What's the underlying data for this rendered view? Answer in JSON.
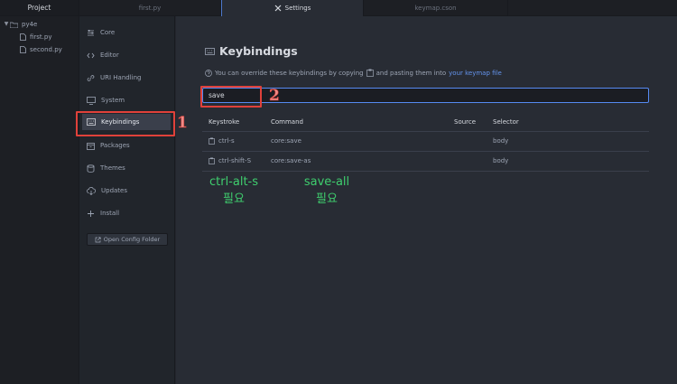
{
  "tree": {
    "header": "Project",
    "root": "py4e",
    "files": [
      "first.py",
      "second.py"
    ]
  },
  "tabs": [
    {
      "label": "first.py",
      "active": false
    },
    {
      "label": "Settings",
      "active": true
    },
    {
      "label": "keymap.cson",
      "active": false
    }
  ],
  "nav": {
    "items": [
      "Core",
      "Editor",
      "URI Handling",
      "System",
      "Keybindings",
      "Packages",
      "Themes",
      "Updates",
      "Install"
    ],
    "selected": "Keybindings",
    "config_button": "Open Config Folder"
  },
  "main": {
    "title": "Keybindings",
    "desc_part1": "You can override these keybindings by copying",
    "desc_part2": "and pasting them into",
    "desc_link": "your keymap file",
    "search_value": "save",
    "columns": [
      "Keystroke",
      "Command",
      "Source",
      "Selector"
    ],
    "rows": [
      {
        "keystroke": "ctrl-s",
        "command": "core:save",
        "source": "",
        "selector": "body"
      },
      {
        "keystroke": "ctrl-shift-S",
        "command": "core:save-as",
        "source": "",
        "selector": "body"
      }
    ]
  },
  "annotations": {
    "label1": "1",
    "label2": "2",
    "note1_line1": "ctrl-alt-s",
    "note1_line2": "필요",
    "note2_line1": "save-all",
    "note2_line2": "필요"
  },
  "colors": {
    "accent": "#568af2",
    "annotation_red": "#e0413a",
    "annotation_green": "#3fce6e"
  }
}
